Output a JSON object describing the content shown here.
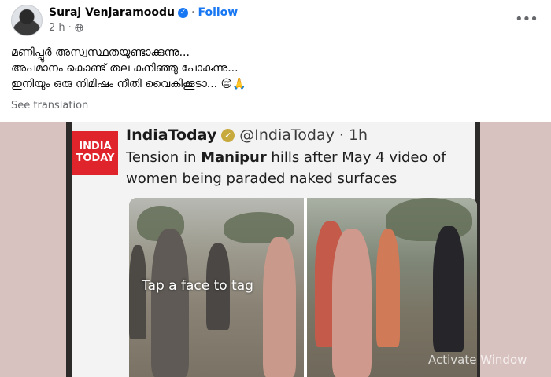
{
  "post": {
    "author_name": "Suraj Venjaramoodu",
    "separator": "·",
    "follow_label": "Follow",
    "timestamp": "2 h",
    "audience_icon": "globe-icon",
    "more_icon": "more-options-icon",
    "lines": [
      "മണിപ്പൂർ അസ്വസ്ഥതയുണ്ടാക്കുന്നു...",
      "അപമാനം കൊണ്ട് തല കുനിഞ്ഞു പോകുന്നു...",
      "ഇനിയും ഒരു നിമിഷം നീതി വൈകിക്കൂടാ... 😔🙏"
    ],
    "see_translation": "See translation"
  },
  "media": {
    "logo_line1": "INDIA",
    "logo_line2": "TODAY",
    "tweet_name": "IndiaToday",
    "tweet_handle": "@IndiaToday · 1h",
    "tweet_text_pre": "Tension in ",
    "tweet_text_bold": "Manipur",
    "tweet_text_post": " hills after May 4 video of women being paraded naked surfaces",
    "tag_overlay": "Tap a face to tag",
    "watermark": "Activate Window"
  },
  "colors": {
    "link_blue": "#1877f2",
    "secondary_text": "#65676b",
    "brand_red": "#e0242b"
  }
}
